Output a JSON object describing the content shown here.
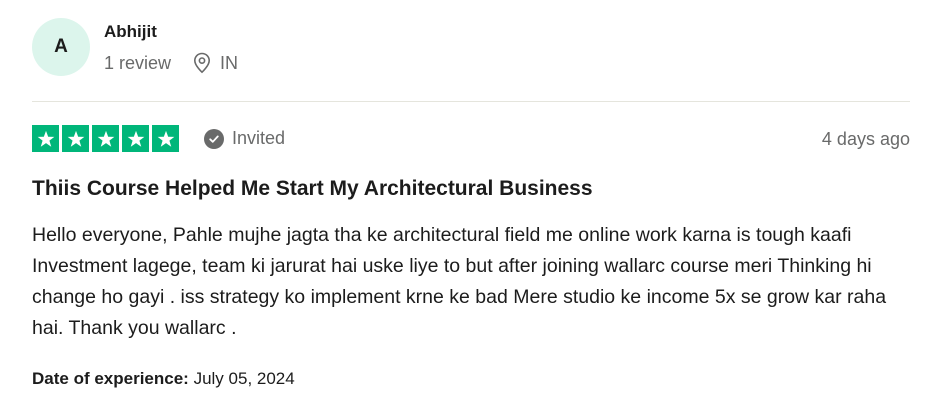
{
  "review": {
    "consumer": {
      "initial": "A",
      "name": "Abhijit",
      "reviews_count": "1 review",
      "country": "IN",
      "avatar_color": "#dcf5ec"
    },
    "rating": 5,
    "rating_max": 5,
    "star_color": "#00b67a",
    "verification": {
      "label": "Invited",
      "icon": "checkmark-circle-icon"
    },
    "posted": "4 days ago",
    "title": "Thiis Course Helped Me Start My Architectural Business",
    "body": "Hello everyone, Pahle mujhe jagta tha ke architectural field me online work karna is tough kaafi Investment lagege, team ki jarurat hai uske liye to but after joining wallarc course meri Thinking hi change ho gayi . iss strategy ko implement krne ke bad Mere studio ke income 5x se grow kar raha hai. Thank you wallarc .",
    "experience": {
      "label": "Date of experience:",
      "date": "July 05, 2024"
    }
  }
}
